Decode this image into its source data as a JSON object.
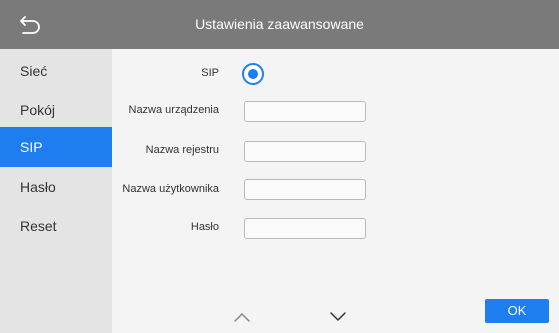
{
  "header": {
    "title": "Ustawienia zaawansowane",
    "back_icon": "back-arrow-icon"
  },
  "sidebar": {
    "items": [
      {
        "label": "Sieć"
      },
      {
        "label": "Pokój"
      },
      {
        "label": "SIP",
        "active": true
      },
      {
        "label": "Hasło"
      },
      {
        "label": "Reset"
      }
    ]
  },
  "form": {
    "sip_label": "SIP",
    "sip_enabled": true,
    "fields": [
      {
        "label": "Nazwa urządzenia",
        "value": ""
      },
      {
        "label": "Nazwa rejestru",
        "value": ""
      },
      {
        "label": "Nazwa użytkownika",
        "value": ""
      },
      {
        "label": "Hasło",
        "value": ""
      }
    ]
  },
  "footer": {
    "up_icon": "chevron-up-icon",
    "down_icon": "chevron-down-icon",
    "ok_label": "OK"
  },
  "colors": {
    "accent": "#1e7ef0",
    "header_bg": "#7a7a7a",
    "sidebar_bg": "#e4e4e4"
  }
}
